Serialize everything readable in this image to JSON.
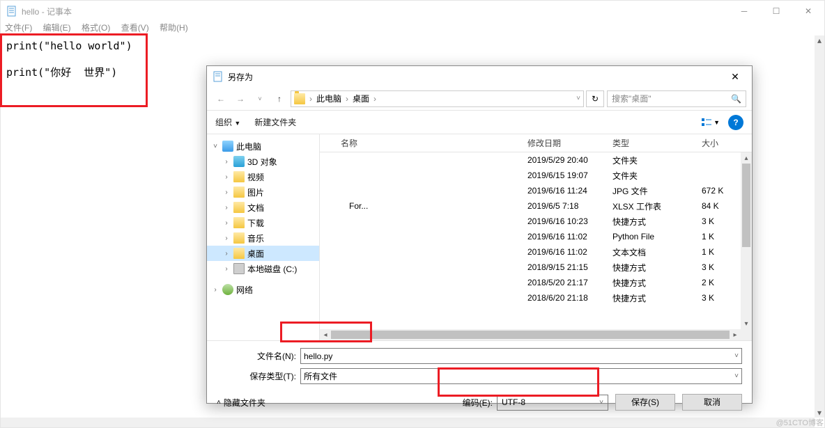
{
  "notepad": {
    "title": "hello - 记事本",
    "menus": {
      "file": "文件(F)",
      "edit": "编辑(E)",
      "format": "格式(O)",
      "view": "查看(V)",
      "help": "帮助(H)"
    },
    "content": "print(\"hello world\")\n\nprint(\"你好  世界\")"
  },
  "saveas": {
    "title": "另存为",
    "breadcrumb": {
      "seg1": "此电脑",
      "seg2": "桌面"
    },
    "search_placeholder": "搜索\"桌面\"",
    "toolbar": {
      "organize": "组织",
      "new_folder": "新建文件夹"
    },
    "tree": {
      "this_pc": "此电脑",
      "objects3d": "3D 对象",
      "videos": "视频",
      "pictures": "图片",
      "documents": "文档",
      "downloads": "下载",
      "music": "音乐",
      "desktop": "桌面",
      "local_disk": "本地磁盘 (C:)",
      "network": "网络"
    },
    "columns": {
      "name": "名称",
      "date": "修改日期",
      "type": "类型",
      "size": "大小"
    },
    "rows": [
      {
        "name_suffix": "",
        "date": "2019/5/29 20:40",
        "type": "文件夹",
        "size": ""
      },
      {
        "name_suffix": "",
        "date": "2019/6/15 19:07",
        "type": "文件夹",
        "size": ""
      },
      {
        "name_suffix": "",
        "date": "2019/6/16 11:24",
        "type": "JPG 文件",
        "size": "672 K"
      },
      {
        "name_suffix": "For...",
        "date": "2019/6/5 7:18",
        "type": "XLSX 工作表",
        "size": "84 K"
      },
      {
        "name_suffix": "",
        "date": "2019/6/16 10:23",
        "type": "快捷方式",
        "size": "3 K"
      },
      {
        "name_suffix": "",
        "date": "2019/6/16 11:02",
        "type": "Python File",
        "size": "1 K"
      },
      {
        "name_suffix": "",
        "date": "2019/6/16 11:02",
        "type": "文本文档",
        "size": "1 K"
      },
      {
        "name_suffix": "",
        "date": "2018/9/15 21:15",
        "type": "快捷方式",
        "size": "3 K"
      },
      {
        "name_suffix": "",
        "date": "2018/5/20 21:17",
        "type": "快捷方式",
        "size": "2 K"
      },
      {
        "name_suffix": "",
        "date": "2018/6/20 21:18",
        "type": "快捷方式",
        "size": "3 K"
      }
    ],
    "filename_label": "文件名(N):",
    "filename_value": "hello.py",
    "filetype_label": "保存类型(T):",
    "filetype_value": "所有文件",
    "hide_folders": "隐藏文件夹",
    "encoding_label": "编码(E):",
    "encoding_value": "UTF-8",
    "save_btn": "保存(S)",
    "cancel_btn": "取消"
  },
  "watermark": "@51CTO博客"
}
